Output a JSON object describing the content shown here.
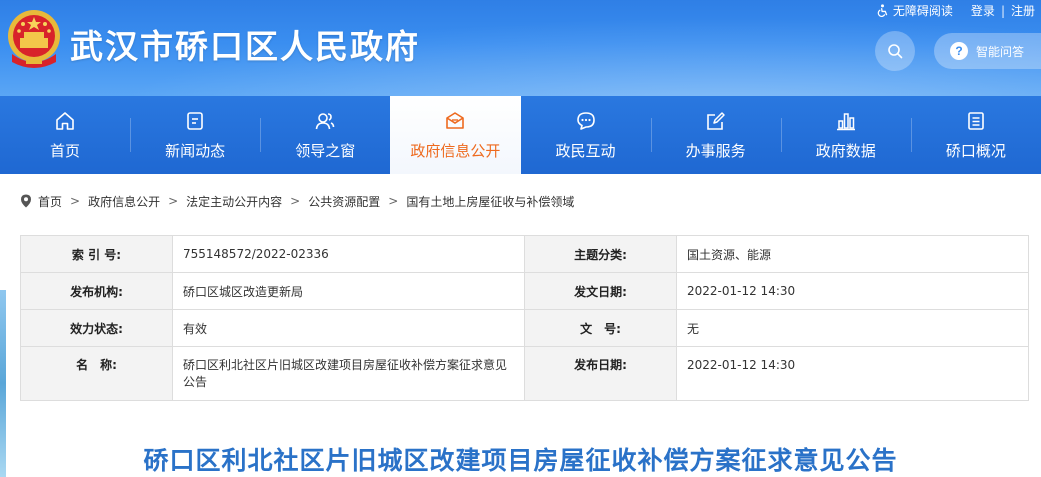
{
  "header": {
    "site_title": "武汉市硚口区人民政府",
    "accessibility_label": "无障碍阅读",
    "login_label": "登录",
    "separator": "|",
    "register_label": "注册",
    "qa_label": "智能问答",
    "qa_mark": "?"
  },
  "nav": {
    "items": [
      {
        "label": "首页",
        "icon": "home-icon"
      },
      {
        "label": "新闻动态",
        "icon": "news-icon"
      },
      {
        "label": "领导之窗",
        "icon": "leaders-icon"
      },
      {
        "label": "政府信息公开",
        "icon": "mail-icon",
        "active": true
      },
      {
        "label": "政民互动",
        "icon": "chat-icon"
      },
      {
        "label": "办事服务",
        "icon": "edit-icon"
      },
      {
        "label": "政府数据",
        "icon": "chart-icon"
      },
      {
        "label": "硚口概况",
        "icon": "document-icon"
      }
    ]
  },
  "breadcrumb": {
    "items": [
      "首页",
      "政府信息公开",
      "法定主动公开内容",
      "公共资源配置",
      "国有土地上房屋征收与补偿领域"
    ],
    "separator": ">"
  },
  "info": {
    "index_label": "索 引 号:",
    "index_value": "755148572/2022-02336",
    "category_label": "主题分类:",
    "category_value": "国土资源、能源",
    "publisher_label": "发布机构:",
    "publisher_value": "硚口区城区改造更新局",
    "issue_date_label": "发文日期:",
    "issue_date_value": "2022-01-12 14:30",
    "status_label": "效力状态:",
    "status_value": "有效",
    "doc_no_label": "文　号:",
    "doc_no_value": "无",
    "name_label": "名　称:",
    "name_value": "硚口区利北社区片旧城区改建项目房屋征收补偿方案征求意见公告",
    "publish_date_label": "发布日期:",
    "publish_date_value": "2022-01-12 14:30"
  },
  "article": {
    "title": "硚口区利北社区片旧城区改建项目房屋征收补偿方案征求意见公告"
  },
  "colors": {
    "header_blue": "#3a8ef0",
    "nav_blue": "#1f68d2",
    "active_orange": "#ee6a1f",
    "title_blue": "#2a72c8"
  }
}
